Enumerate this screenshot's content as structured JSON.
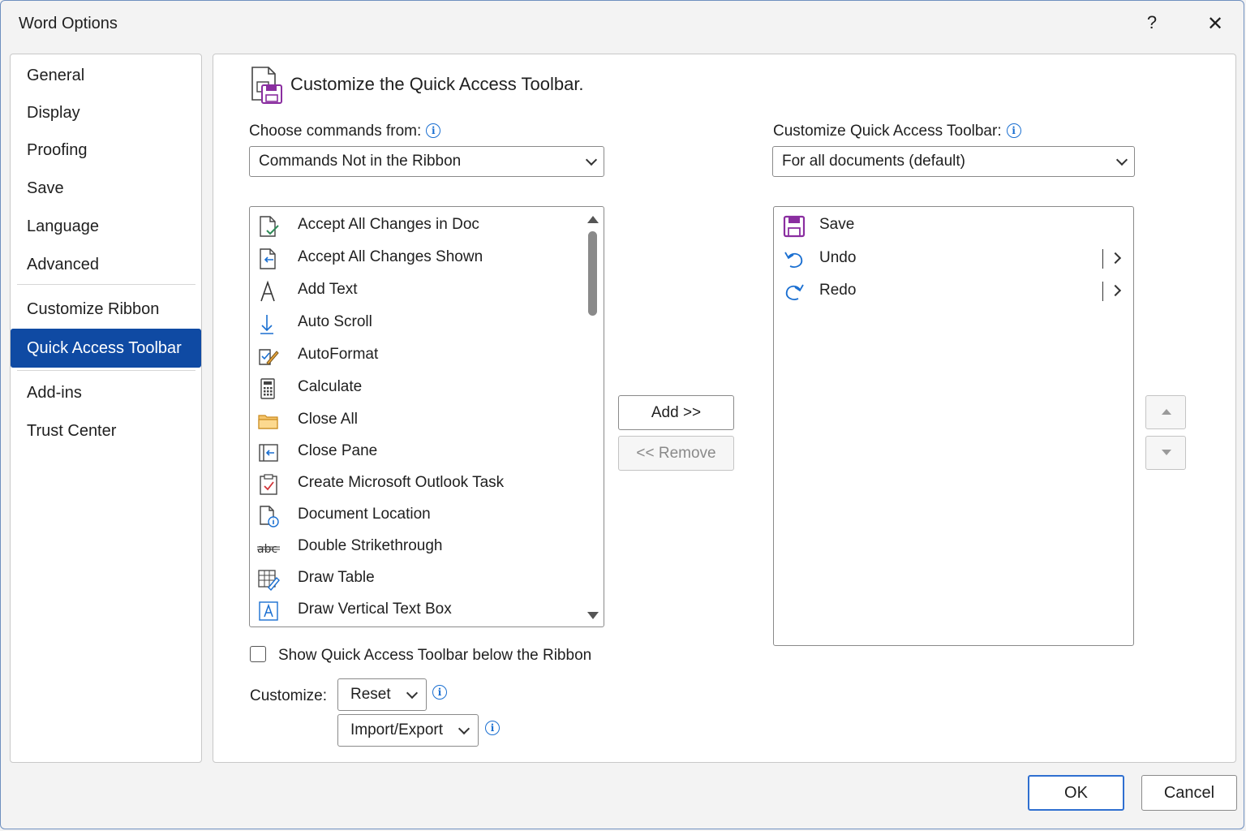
{
  "window": {
    "title": "Word Options",
    "help_glyph": "?",
    "close_glyph": "✕"
  },
  "sidebar": {
    "items": [
      {
        "label": "General"
      },
      {
        "label": "Display"
      },
      {
        "label": "Proofing"
      },
      {
        "label": "Save"
      },
      {
        "label": "Language"
      },
      {
        "label": "Advanced"
      },
      {
        "label": "Customize Ribbon"
      },
      {
        "label": "Quick Access Toolbar"
      },
      {
        "label": "Add-ins"
      },
      {
        "label": "Trust Center"
      }
    ],
    "selected": "Quick Access Toolbar"
  },
  "main": {
    "heading": "Customize the Quick Access Toolbar.",
    "choose_label": "Choose commands from:",
    "choose_value": "Commands Not in the Ribbon",
    "customize_qat_label": "Customize Quick Access Toolbar:",
    "customize_qat_value": "For all documents (default)",
    "commands": [
      {
        "label": "Accept All Changes in Doc",
        "icon": "document-check-icon"
      },
      {
        "label": "Accept All Changes Shown",
        "icon": "document-accept-icon"
      },
      {
        "label": "Add Text",
        "icon": "text-a-icon"
      },
      {
        "label": "Auto Scroll",
        "icon": "arrow-down-icon"
      },
      {
        "label": "AutoFormat",
        "icon": "autoformat-icon"
      },
      {
        "label": "Calculate",
        "icon": "calculator-icon"
      },
      {
        "label": "Close All",
        "icon": "folder-icon"
      },
      {
        "label": "Close Pane",
        "icon": "close-pane-icon"
      },
      {
        "label": "Create Microsoft Outlook Task",
        "icon": "clipboard-check-icon"
      },
      {
        "label": "Document Location",
        "icon": "document-info-icon"
      },
      {
        "label": "Double Strikethrough",
        "icon": "strikethrough-icon"
      },
      {
        "label": "Draw Table",
        "icon": "draw-table-icon"
      },
      {
        "label": "Draw Vertical Text Box",
        "icon": "text-box-icon"
      }
    ],
    "toolbar_items": [
      {
        "label": "Save",
        "icon": "save-icon",
        "has_submenu": false
      },
      {
        "label": "Undo",
        "icon": "undo-icon",
        "has_submenu": true
      },
      {
        "label": "Redo",
        "icon": "redo-icon",
        "has_submenu": true
      }
    ],
    "add_label": "Add >>",
    "remove_label": "<< Remove",
    "show_below_label": "Show Quick Access Toolbar below the Ribbon",
    "show_below_checked": false,
    "customize_label": "Customize:",
    "reset_label": "Reset",
    "import_export_label": "Import/Export",
    "info_glyph": "i"
  },
  "footer": {
    "ok_label": "OK",
    "cancel_label": "Cancel"
  },
  "colors": {
    "accent": "#0f4aa3",
    "info": "#1a6fd1",
    "save_purple": "#8a2ea0",
    "redo_blue": "#1a6fd1"
  }
}
